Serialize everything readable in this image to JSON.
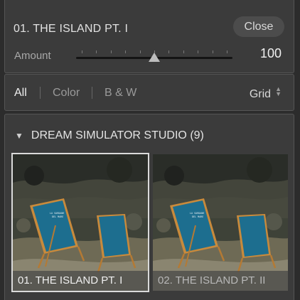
{
  "preset": {
    "title": "01. THE ISLAND PT. I",
    "close_label": "Close"
  },
  "amount": {
    "label": "Amount",
    "value": "100",
    "level_fraction": 0.5
  },
  "filters": {
    "all": "All",
    "color": "Color",
    "bw": "B & W",
    "view": "Grid"
  },
  "group": {
    "title": "DREAM SIMULATOR STUDIO (9)",
    "expanded": true
  },
  "thumbnails": [
    {
      "label": "01. THE ISLAND PT. I",
      "selected": true
    },
    {
      "label": "02. THE ISLAND PT. II",
      "selected": false
    }
  ],
  "chair_print": [
    "LA SARDANE",
    "DEL MARE"
  ],
  "icons": {
    "expand": "triangle-down-icon",
    "sort": "up-down-arrows-icon"
  }
}
